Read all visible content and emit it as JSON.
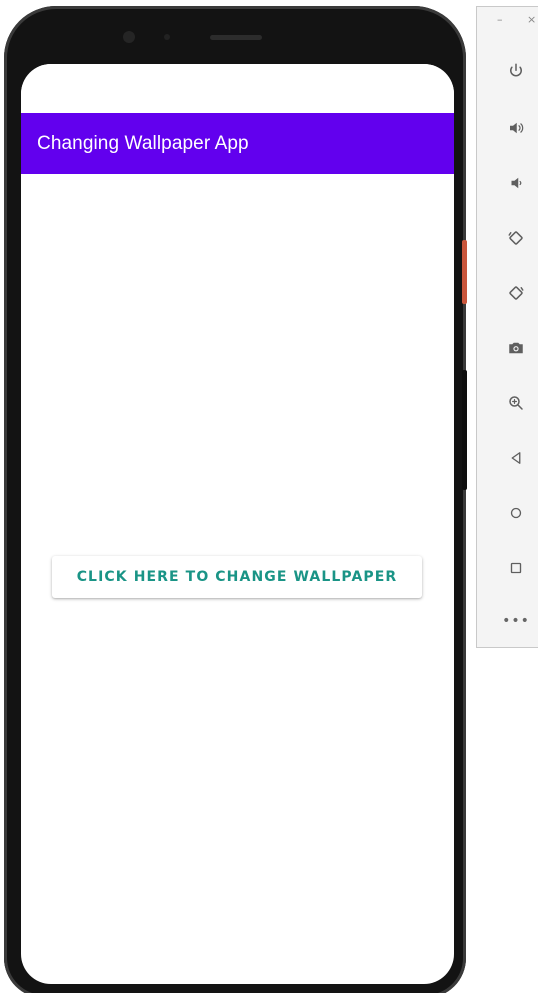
{
  "app": {
    "title": "Changing Wallpaper App",
    "primary_color": "#6200ee",
    "title_color": "#ffffff"
  },
  "main": {
    "change_button_label": "CLICK HERE TO CHANGE WALLPAPER",
    "button_text_color": "#1a9486"
  },
  "emulator_toolbar": {
    "window_controls": [
      "minimize-icon",
      "close-icon"
    ],
    "tools": [
      "power-icon",
      "volume-up-icon",
      "volume-down-icon",
      "rotate-left-icon",
      "rotate-right-icon",
      "camera-icon",
      "zoom-icon",
      "back-icon",
      "home-icon",
      "overview-icon",
      "more-icon"
    ]
  }
}
